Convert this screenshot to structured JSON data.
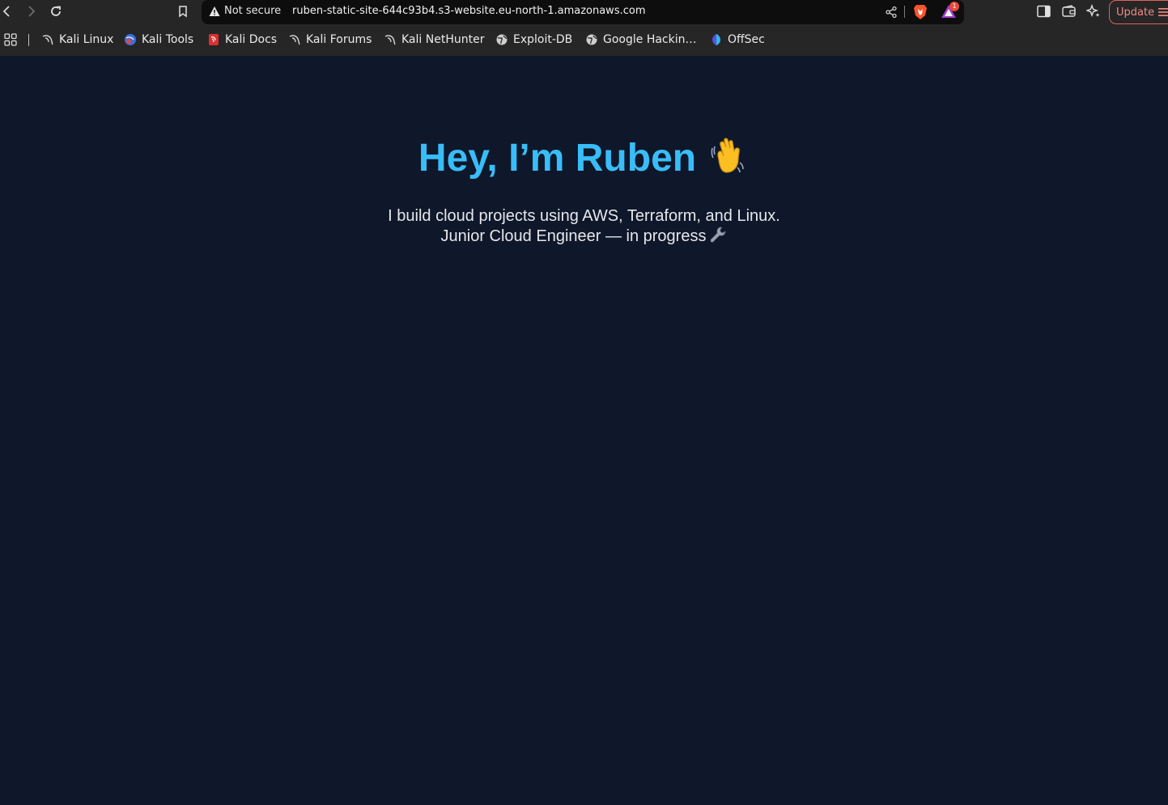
{
  "browser": {
    "security_label": "Not secure",
    "url": "ruben-static-site-644c93b4.s3-website.eu-north-1.amazonaws.com",
    "rewards_badge_count": "1",
    "update_label": "Update"
  },
  "bookmarks": [
    {
      "label": "Kali Linux",
      "icon": "kali-dragon-icon"
    },
    {
      "label": "Kali Tools",
      "icon": "kali-tools-icon"
    },
    {
      "label": "Kali Docs",
      "icon": "kali-docs-icon"
    },
    {
      "label": "Kali Forums",
      "icon": "kali-dragon-icon"
    },
    {
      "label": "Kali NetHunter",
      "icon": "kali-dragon-icon"
    },
    {
      "label": "Exploit-DB",
      "icon": "globe-icon"
    },
    {
      "label": "Google Hackin…",
      "icon": "globe-icon"
    },
    {
      "label": "OffSec",
      "icon": "offsec-icon"
    }
  ],
  "page": {
    "title": "Hey, I’m Ruben",
    "tagline_line1": "I build cloud projects using AWS, Terraform, and Linux.",
    "tagline_line2": "Junior Cloud Engineer — in progress",
    "colors": {
      "background": "#0f172a",
      "title": "#38bdf8",
      "text": "#e5e7eb"
    }
  }
}
